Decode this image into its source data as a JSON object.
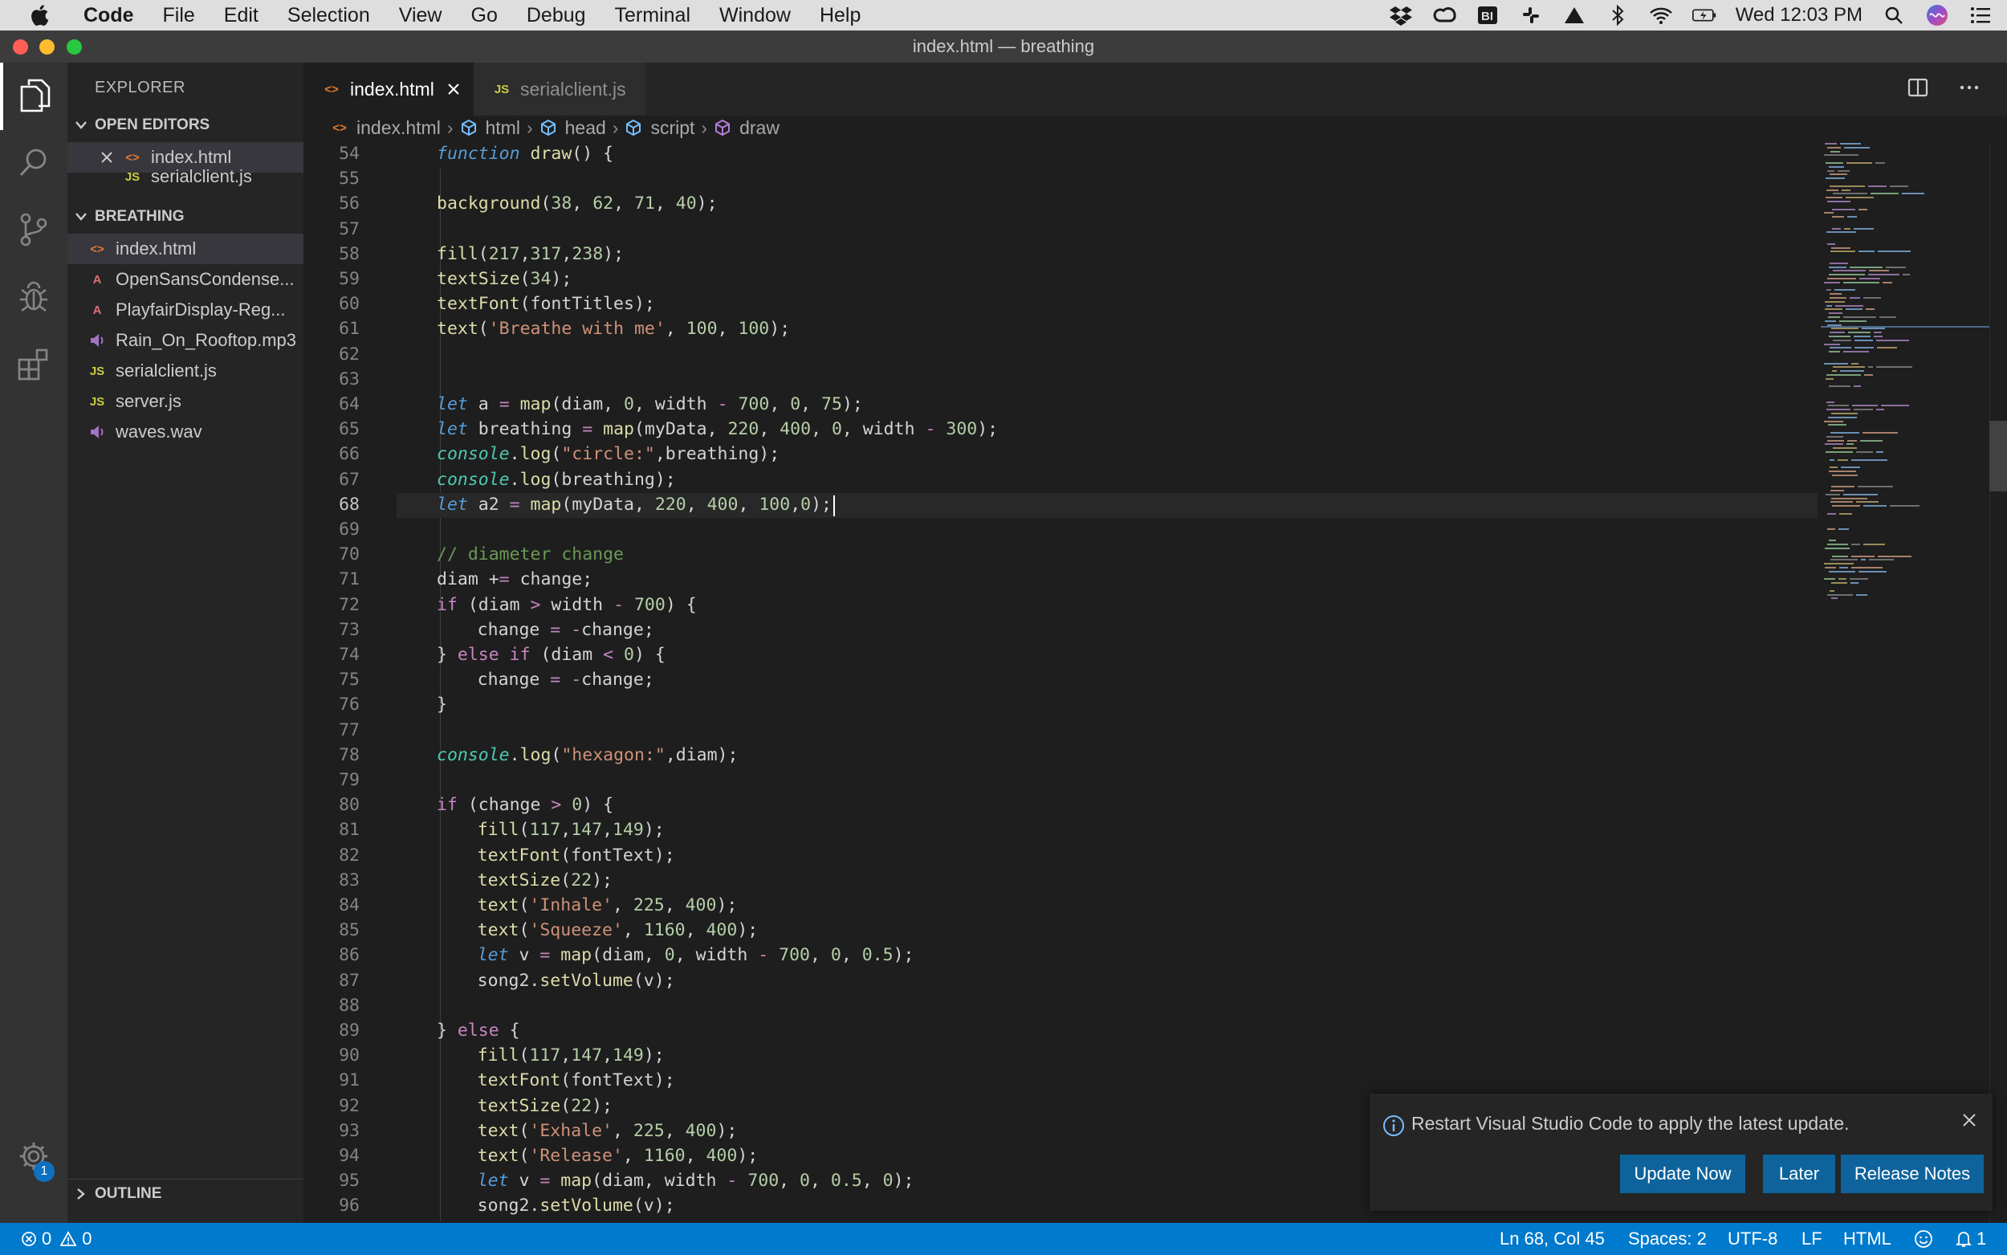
{
  "menubar": {
    "app": "Code",
    "items": [
      "File",
      "Edit",
      "Selection",
      "View",
      "Go",
      "Debug",
      "Terminal",
      "Window",
      "Help"
    ],
    "clock": "Wed 12:03 PM"
  },
  "window": {
    "title": "index.html — breathing"
  },
  "activity": {
    "settings_badge": "1"
  },
  "sidebar": {
    "title": "EXPLORER",
    "open_editors_label": "OPEN EDITORS",
    "open_editors": [
      {
        "name": "index.html",
        "icon": "html-file-icon"
      },
      {
        "name": "serialclient.js",
        "icon": "js-file-icon"
      }
    ],
    "folder_label": "BREATHING",
    "files": [
      {
        "name": "index.html",
        "icon": "html-file-icon"
      },
      {
        "name": "OpenSansCondense...",
        "icon": "font-file-icon"
      },
      {
        "name": "PlayfairDisplay-Reg...",
        "icon": "font-file-icon"
      },
      {
        "name": "Rain_On_Rooftop.mp3",
        "icon": "audio-file-icon"
      },
      {
        "name": "serialclient.js",
        "icon": "js-file-icon"
      },
      {
        "name": "server.js",
        "icon": "js-file-icon"
      },
      {
        "name": "waves.wav",
        "icon": "audio-file-icon"
      }
    ],
    "outline_label": "OUTLINE"
  },
  "tabs": [
    {
      "label": "index.html",
      "active": true
    },
    {
      "label": "serialclient.js",
      "active": false
    }
  ],
  "breadcrumb": [
    "index.html",
    "html",
    "head",
    "script",
    "draw"
  ],
  "editor": {
    "lines": [
      {
        "n": "54",
        "t": "function draw() {"
      },
      {
        "n": "55",
        "t": ""
      },
      {
        "n": "56",
        "t": "  background(38, 62, 71, 40);"
      },
      {
        "n": "57",
        "t": ""
      },
      {
        "n": "58",
        "t": "  fill(217,317,238);"
      },
      {
        "n": "59",
        "t": "  textSize(34);"
      },
      {
        "n": "60",
        "t": "  textFont(fontTitles);"
      },
      {
        "n": "61",
        "t": "  text('Breathe with me', 100, 100);"
      },
      {
        "n": "62",
        "t": ""
      },
      {
        "n": "63",
        "t": ""
      },
      {
        "n": "64",
        "t": "  let a = map(diam, 0, width - 700, 0, 75);"
      },
      {
        "n": "65",
        "t": "  let breathing = map(myData, 220, 400, 0, width - 300);"
      },
      {
        "n": "66",
        "t": "  console.log(\"circle:\",breathing);"
      },
      {
        "n": "67",
        "t": "  console.log(breathing);"
      },
      {
        "n": "68",
        "t": "  let a2 = map(myData, 220, 400, 100,0);"
      },
      {
        "n": "69",
        "t": ""
      },
      {
        "n": "70",
        "t": "  // diameter change"
      },
      {
        "n": "71",
        "t": "  diam += change;"
      },
      {
        "n": "72",
        "t": "  if (diam > width - 700) {"
      },
      {
        "n": "73",
        "t": "    change = -change;"
      },
      {
        "n": "74",
        "t": "  } else if (diam < 0) {"
      },
      {
        "n": "75",
        "t": "    change = -change;"
      },
      {
        "n": "76",
        "t": "  }"
      },
      {
        "n": "77",
        "t": ""
      },
      {
        "n": "78",
        "t": "  console.log(\"hexagon:\",diam);"
      },
      {
        "n": "79",
        "t": ""
      },
      {
        "n": "80",
        "t": "  if (change > 0) {"
      },
      {
        "n": "81",
        "t": "    fill(117,147,149);"
      },
      {
        "n": "82",
        "t": "    textFont(fontText);"
      },
      {
        "n": "83",
        "t": "    textSize(22);"
      },
      {
        "n": "84",
        "t": "    text('Inhale', 225, 400);"
      },
      {
        "n": "85",
        "t": "    text('Squeeze', 1160, 400);"
      },
      {
        "n": "86",
        "t": "    let v = map(diam, 0, width - 700, 0, 0.5);"
      },
      {
        "n": "87",
        "t": "    song2.setVolume(v);"
      },
      {
        "n": "88",
        "t": ""
      },
      {
        "n": "89",
        "t": "  } else {"
      },
      {
        "n": "90",
        "t": "    fill(117,147,149);"
      },
      {
        "n": "91",
        "t": "    textFont(fontText);"
      },
      {
        "n": "92",
        "t": "    textSize(22);"
      },
      {
        "n": "93",
        "t": "    text('Exhale', 225, 400);"
      },
      {
        "n": "94",
        "t": "    text('Release', 1160, 400);"
      },
      {
        "n": "95",
        "t": "    let v = map(diam, width - 700, 0, 0.5, 0);"
      },
      {
        "n": "96",
        "t": "    song2.setVolume(v);"
      }
    ],
    "current_line": "68"
  },
  "notification": {
    "message": "Restart Visual Studio Code to apply the latest update.",
    "buttons": [
      "Update Now",
      "Later",
      "Release Notes"
    ]
  },
  "statusbar": {
    "errors": "0",
    "warnings": "0",
    "position": "Ln 68, Col 45",
    "spaces": "Spaces: 2",
    "encoding": "UTF-8",
    "eol": "LF",
    "language": "HTML",
    "bell_count": "1"
  },
  "colors": {
    "accent": "#007acc",
    "button": "#0e639c",
    "editor_bg": "#1e1e1e",
    "sidebar_bg": "#252526"
  }
}
